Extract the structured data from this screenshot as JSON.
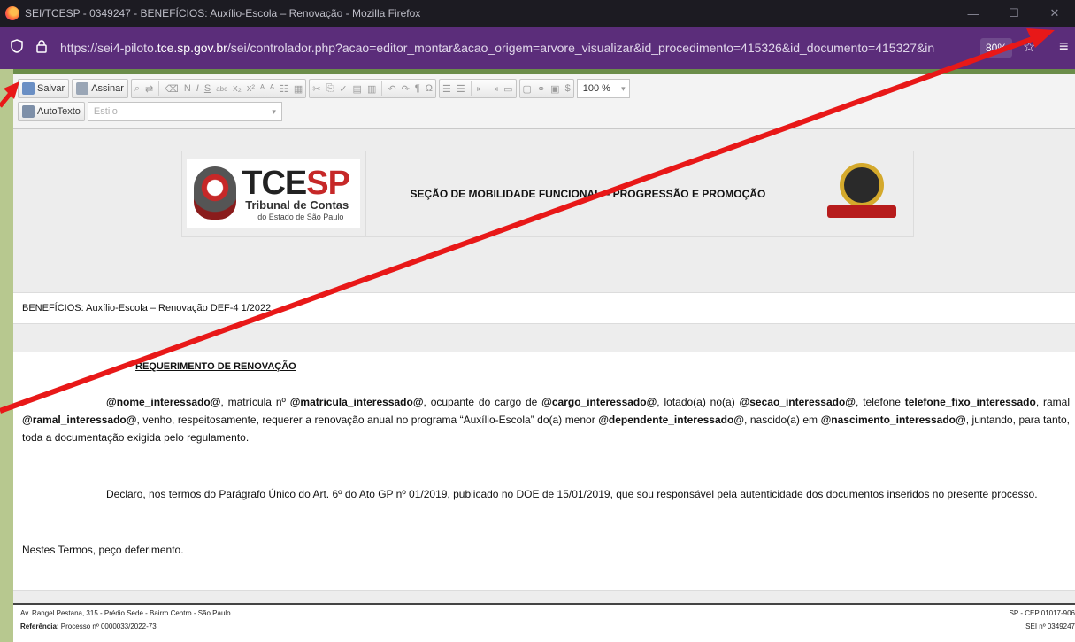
{
  "window": {
    "title": "SEI/TCESP - 0349247 - BENEFÍCIOS: Auxílio-Escola – Renovação - Mozilla Firefox",
    "controls": [
      "—",
      "☐",
      "✕"
    ]
  },
  "navbar": {
    "url_prefix": "https://sei4-piloto.",
    "url_domain": "tce.sp.gov.br",
    "url_suffix": "/sei/controlador.php?acao=editor_montar&acao_origem=arvore_visualizar&id_procedimento=415326&id_documento=415327&in",
    "zoom": "80%"
  },
  "toolbar": {
    "save_label": "Salvar",
    "sign_label": "Assinar",
    "format_glyphs": [
      "N",
      "I",
      "S",
      "abc",
      "x₂",
      "x²"
    ],
    "zoom_value": "100 %",
    "autotext_label": "AutoTexto",
    "style_placeholder": "Estilo"
  },
  "document": {
    "logo_main_1": "TCE",
    "logo_main_2": "SP",
    "logo_sub": "Tribunal de Contas",
    "logo_sub2": "do Estado de São Paulo",
    "header_title": "SEÇÃO DE MOBILIDADE FUNCIONAL – PROGRESSÃO E PROMOÇÃO",
    "sei_line": "BENEFÍCIOS: Auxílio-Escola – Renovação DEF-4 1/2022",
    "request_title": "REQUERIMENTO DE RENOVAÇÃO",
    "p1_nome": "@nome_interessado@",
    "p1_t1": ", matrícula nº ",
    "p1_matricula": "@matricula_interessado@",
    "p1_t2": ", ocupante do cargo de ",
    "p1_cargo": "@cargo_interessado@",
    "p1_t3": ", lotado(a) no(a) ",
    "p1_secao": "@secao_interessado@",
    "p1_t4": ", telefone ",
    "p1_telefone": "telefone_fixo_interessado",
    "p1_t5": ", ramal ",
    "p1_ramal": "@ramal_interessado@",
    "p1_t6": ", venho, respeitosamente, requerer a renovação anual no programa “Auxílio-Escola” do(a) menor ",
    "p1_dependente": "@dependente_interessado@",
    "p1_t7": ", nascido(a) em ",
    "p1_nascimento": "@nascimento_interessado@",
    "p1_t8": ", juntando, para tanto, toda a documentação exigida pelo regulamento.",
    "p2": "Declaro, nos termos do Parágrafo Único do Art. 6º do Ato GP nº 01/2019, publicado no DOE de 15/01/2019, que sou responsável pela autenticidade dos documentos inseridos no presente processo.",
    "p3": "Nestes Termos, peço deferimento."
  },
  "footer": {
    "address": "Av. Rangel Pestana, 315 - Prédio Sede - Bairro Centro - São Paulo",
    "ref_label": "Referência:",
    "ref_value": " Processo nº 0000033/2022-73",
    "cep": "SP - CEP 01017-906",
    "sei_number": "SEI nº 0349247"
  },
  "colors": {
    "titlebar": "#1c1b22",
    "urlbar": "#5b2d7a",
    "arrow": "#e81818"
  }
}
